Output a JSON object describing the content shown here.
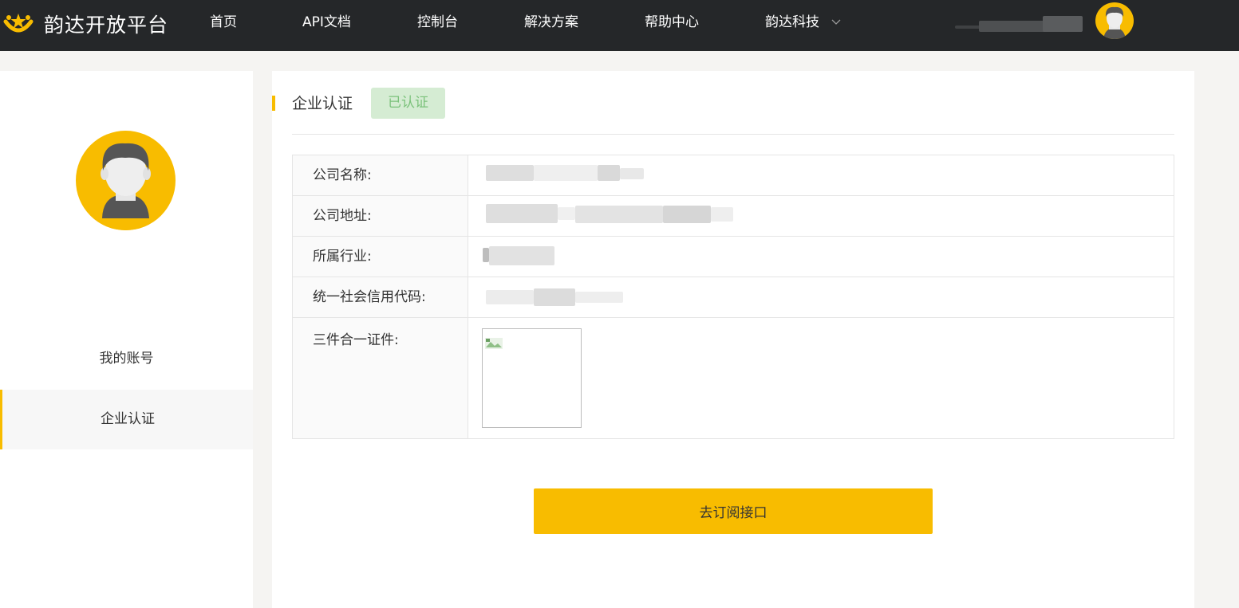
{
  "header": {
    "logo_text": "韵达开放平台",
    "nav": [
      {
        "label": "首页"
      },
      {
        "label": "API文档"
      },
      {
        "label": "控制台"
      },
      {
        "label": "解决方案"
      },
      {
        "label": "帮助中心"
      },
      {
        "label": "韵达科技"
      }
    ],
    "avatar_icon": "user-avatar-icon"
  },
  "sidebar": {
    "avatar_icon": "user-avatar-icon",
    "items": [
      {
        "label": "我的账号",
        "active": false
      },
      {
        "label": "企业认证",
        "active": true
      }
    ]
  },
  "main": {
    "title": "企业认证",
    "status_badge": "已认证",
    "fields": [
      {
        "label": "公司名称:"
      },
      {
        "label": "公司地址:"
      },
      {
        "label": "所属行业:"
      },
      {
        "label": "统一社会信用代码:"
      },
      {
        "label": "三件合一证件:"
      }
    ],
    "subscribe_button": "去订阅接口"
  },
  "colors": {
    "accent": "#f8bc00",
    "header_bg": "#252729",
    "badge_bg": "#d5ecd3",
    "badge_text": "#7bc27b"
  }
}
